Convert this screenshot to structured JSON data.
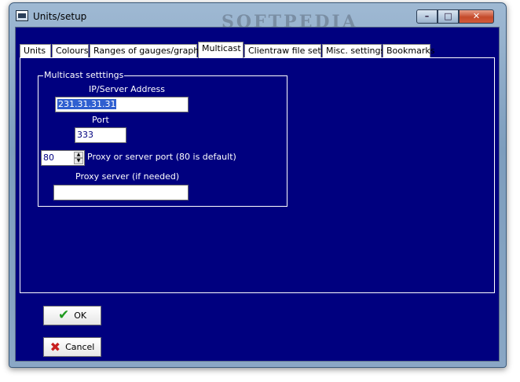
{
  "window": {
    "title": "Units/setup",
    "watermark": "SOFTPEDIA",
    "controls": {
      "minimize": "–",
      "maximize": "□",
      "close": "✕"
    }
  },
  "tabs": [
    {
      "label": "Units",
      "active": false
    },
    {
      "label": "Colours",
      "active": false
    },
    {
      "label": "Ranges of gauges/graph",
      "active": false
    },
    {
      "label": "Multicast",
      "active": true
    },
    {
      "label": "Clientraw file setup",
      "active": false
    },
    {
      "label": "Misc. settings",
      "active": false
    },
    {
      "label": "Bookmarks",
      "active": false
    }
  ],
  "multicast": {
    "group_title": "Multicast setttings",
    "ip_label": "IP/Server Address",
    "ip_value": "231.31.31.31",
    "port_label": "Port",
    "port_value": "333",
    "proxy_port_value": "80",
    "proxy_port_label": "Proxy or server port (80 is default)",
    "proxy_server_label": "Proxy server (if needed)",
    "proxy_server_value": ""
  },
  "buttons": {
    "ok": "OK",
    "cancel": "Cancel"
  },
  "icons": {
    "ok": "check-icon",
    "cancel": "x-icon",
    "spin_up": "spin-up-icon",
    "spin_down": "spin-down-icon"
  },
  "colors": {
    "client_bg": "#00007f",
    "text": "#ffffff",
    "selection": "#2f5fd0"
  }
}
